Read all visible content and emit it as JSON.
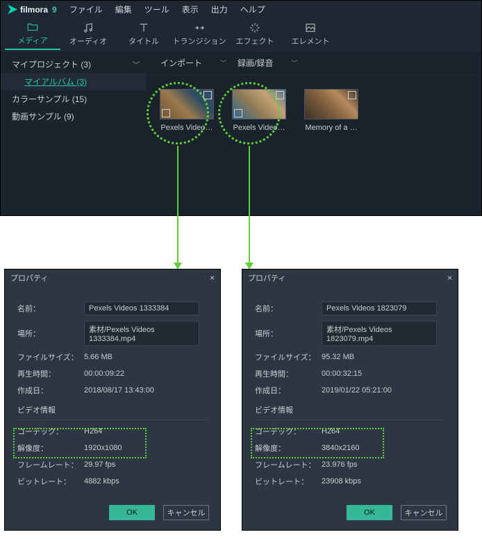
{
  "brand": {
    "name": "filmora",
    "suffix": "9"
  },
  "menu": {
    "file": "ファイル",
    "edit": "編集",
    "tool": "ツール",
    "view": "表示",
    "export": "出力",
    "help": "ヘルプ"
  },
  "tabs": {
    "media": "メディア",
    "audio": "オーディオ",
    "title": "タイトル",
    "transition": "トランジション",
    "effect": "エフェクト",
    "element": "エレメント"
  },
  "sidebar": {
    "items": [
      {
        "label": "マイプロジェクト (3)"
      },
      {
        "label": "マイアルバム  (3)"
      },
      {
        "label": "カラーサンプル (15)"
      },
      {
        "label": "動画サンプル (9)"
      }
    ]
  },
  "contentBar": {
    "import": "インポート",
    "record": "録画/録音"
  },
  "thumbs": [
    {
      "label": "Pexels Video…"
    },
    {
      "label": "Pexels Video…"
    },
    {
      "label": "Memory of a …"
    }
  ],
  "dialogTitle": "プロパティ",
  "labels": {
    "name": "名前：",
    "location": "場所：",
    "filesize": "ファイルサイズ：",
    "duration": "再生時間：",
    "created": "作成日：",
    "videoInfo": "ビデオ情報",
    "codec": "コーデック：",
    "resolution": "解像度：",
    "framerate": "フレームレート：",
    "bitrate": "ビットレート：",
    "ok": "OK",
    "cancel": "キャンセル"
  },
  "dlg1": {
    "name": "Pexels Videos 1333384",
    "location": "素材/Pexels Videos 1333384.mp4",
    "filesize": "5.66 MB",
    "duration": "00:00:09:22",
    "created": "2018/08/17 13:43:00",
    "codec": "H264",
    "resolution": "1920x1080",
    "framerate": "29.97 fps",
    "bitrate": "4882 kbps"
  },
  "dlg2": {
    "name": "Pexels Videos 1823079",
    "location": "素材/Pexels Videos 1823079.mp4",
    "filesize": "95.32 MB",
    "duration": "00:00:32:15",
    "created": "2019/01/22 05:21:00",
    "codec": "H264",
    "resolution": "3840x2160",
    "framerate": "23.976 fps",
    "bitrate": "23908 kbps"
  }
}
